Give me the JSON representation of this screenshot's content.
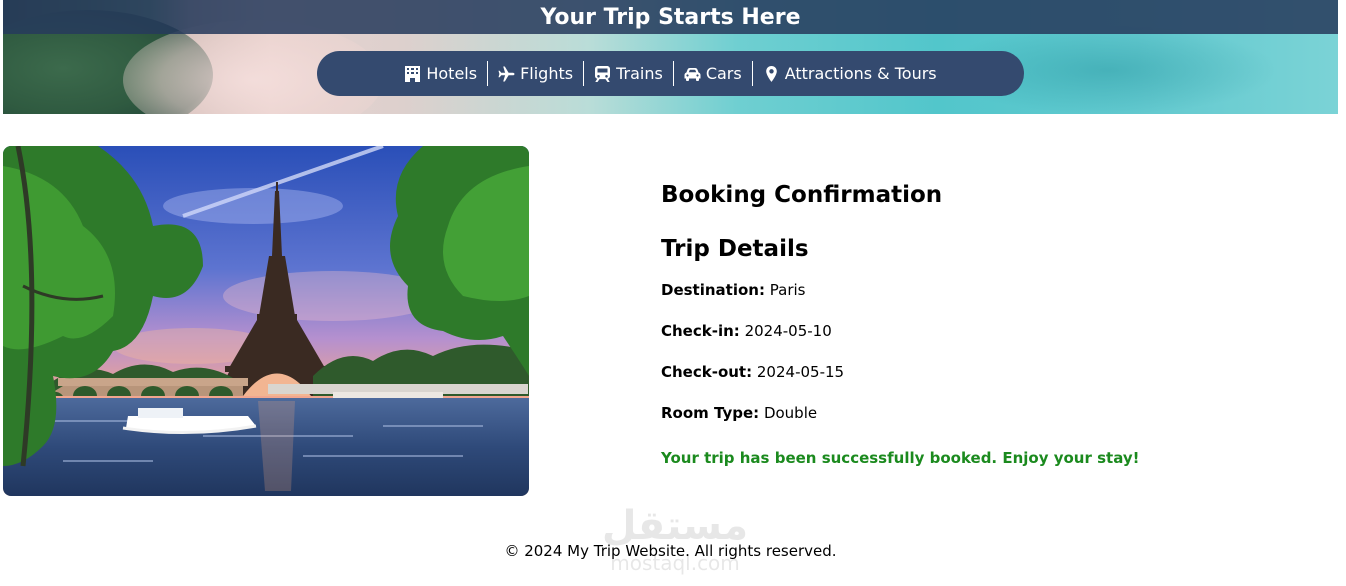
{
  "header": {
    "title": "Your Trip Starts Here"
  },
  "nav": {
    "items": [
      {
        "label": "Hotels",
        "icon": "hotel-icon"
      },
      {
        "label": "Flights",
        "icon": "plane-icon"
      },
      {
        "label": "Trains",
        "icon": "train-icon"
      },
      {
        "label": "Cars",
        "icon": "car-icon"
      },
      {
        "label": "Attractions & Tours",
        "icon": "map-pin-icon"
      }
    ]
  },
  "booking": {
    "heading": "Booking Confirmation",
    "subheading": "Trip Details",
    "destination_label": "Destination:",
    "destination_value": "Paris",
    "checkin_label": "Check-in:",
    "checkin_value": "2024-05-10",
    "checkout_label": "Check-out:",
    "checkout_value": "2024-05-15",
    "room_label": "Room Type:",
    "room_value": "Double",
    "success_message": "Your trip has been successfully booked. Enjoy your stay!"
  },
  "footer": {
    "text": "© 2024 My Trip Website. All rights reserved."
  },
  "watermark": {
    "logo": "مستقل",
    "sub": "mostaql.com"
  },
  "colors": {
    "title_bar": "#263a5c",
    "nav_bg": "#344a6f",
    "success": "#1b8a1e"
  }
}
